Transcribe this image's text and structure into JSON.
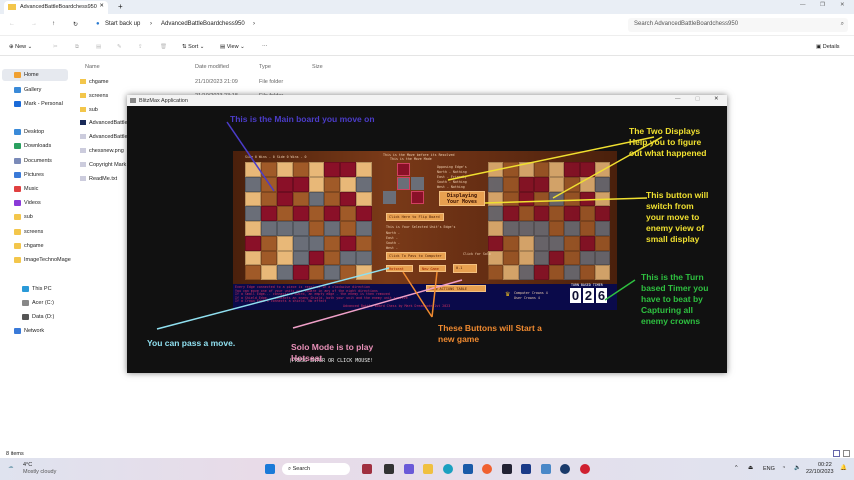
{
  "explorer": {
    "tab_title": "AdvancedBattleBoardchess950",
    "new_tab": "+",
    "breadcrumb": [
      "Start back up",
      "AdvancedBattleBoardchess950"
    ],
    "search_placeholder": "Search AdvancedBattleBoardchess950",
    "toolbar": {
      "new": "New",
      "sort": "Sort",
      "view": "View",
      "more": "···",
      "details": "Details"
    },
    "columns": [
      "Name",
      "Date modified",
      "Type",
      "Size"
    ],
    "files": [
      {
        "name": "chgame",
        "date": "21/10/2023 21:09",
        "type": "File folder"
      },
      {
        "name": "screens",
        "date": "21/10/2023 23:18",
        "type": "File folder"
      },
      {
        "name": "sub",
        "date": "",
        "type": ""
      },
      {
        "name": "AdvancedBattle",
        "date": "",
        "type": ""
      },
      {
        "name": "AdvancedBattle",
        "date": "",
        "type": ""
      },
      {
        "name": "chessnew.png",
        "date": "",
        "type": ""
      },
      {
        "name": "Copyright Mark",
        "date": "",
        "type": ""
      },
      {
        "name": "ReadMe.txt",
        "date": "",
        "type": ""
      }
    ],
    "sidebar": [
      "Home",
      "Gallery",
      "Mark - Personal",
      "Desktop",
      "Downloads",
      "Documents",
      "Pictures",
      "Music",
      "Videos",
      "sub",
      "screens",
      "chgame",
      "ImageTechnoMage",
      "This PC",
      "Acer (C:)",
      "Data (D:)",
      "Network"
    ],
    "status": "8 items"
  },
  "game_window": {
    "title": "BlitzMax Application",
    "score_left": "Side 0 Wins - 0     Side 0 Wins - 0",
    "move_header": [
      "This is the Move before its Resolved",
      "This is the Move Made"
    ],
    "opposing_edges": [
      "Opposing Edge's",
      "North - Nothing",
      "East - Friendly",
      "South - Nothing",
      "West - Nothing"
    ],
    "flip_button": "Click Here to Flip Board",
    "display_button": "Displaying Your Moves",
    "selected_header": "This is Your Selected Unit's Edge's",
    "selected_edges": [
      "North -",
      "East -",
      "South -",
      "West -"
    ],
    "pass_button": "Click To Pass to Computer",
    "hotseat_button": "Hotseat",
    "new_game_button": "New Game",
    "solo_label": "Click for Solo",
    "solo_button": "0.1",
    "rules_button": "SHOW ACTIONS TABLE",
    "info_lines": [
      "Every Edge connected to a piece is resolved in a clockwise direction",
      "You can move one of your units one square in any of the eight directions",
      "If a Small Edge... connects a Sword, an empty edge - the enemy is then removed",
      "If a Shield Edge... contacts an enemy Shield, both your unit and the enemy unit survive",
      "If a Crown Edge's connects a shield. No effect"
    ],
    "credit": "Advanced Battle Board Chess by Mark Dreamcode 1st 2023",
    "computer_crowns": "Computer Crowns 4",
    "user_crowns": "User Crowns 4",
    "timer_label": "TURN BASED TIMER",
    "timer_digits": [
      "0",
      "2",
      "6"
    ],
    "press_prompt": "(PRESS ENTER OR CLICK MOUSE!"
  },
  "annotations": {
    "main_board": "This is the Main board you move on",
    "two_displays": [
      "The Two Displays",
      "Help you to figure",
      "out what happened"
    ],
    "switch_button": [
      "This button will",
      "switch from",
      "your move to",
      "enemy view of",
      "small display"
    ],
    "timer": [
      "This is the Turn",
      "based Timer you",
      "have to beat by",
      "Capturing all",
      "enemy crowns"
    ],
    "pass": "You can pass a move.",
    "solo": [
      "Solo Mode is to play",
      "Hotseat"
    ],
    "new_game": [
      "These Buttons will Start a",
      "new game"
    ]
  },
  "taskbar": {
    "weather_temp": "4°C",
    "weather_text": "Mostly cloudy",
    "search": "Search",
    "lang": "ENG",
    "time": "00:22",
    "date": "22/10/2023"
  },
  "colors": {
    "purple": "#4b3cc8",
    "yellow": "#f0e030",
    "green": "#2ec040",
    "cyan": "#90e0f0",
    "pink": "#f0a0c8",
    "orange": "#f08a30",
    "board_red": "#8a1028",
    "board_grey": "#6a6e78"
  }
}
